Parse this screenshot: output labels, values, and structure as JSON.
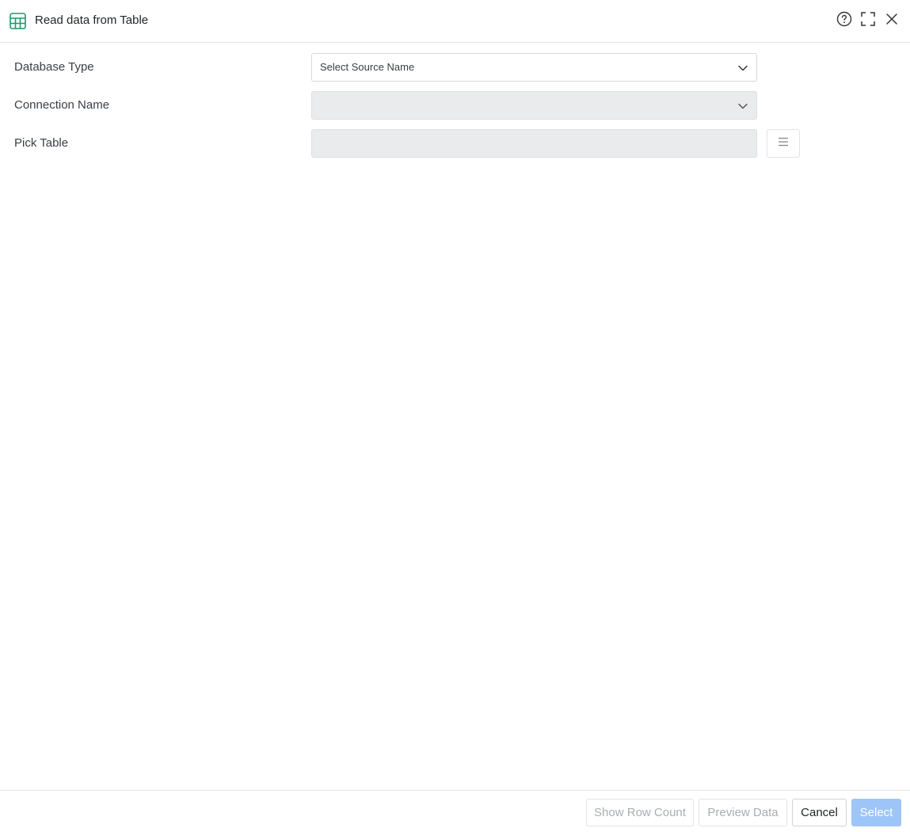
{
  "dialog": {
    "title": "Read data from Table",
    "icon": "table-icon",
    "accent_color": "#1a9a6a"
  },
  "header_actions": {
    "help_icon": "help-circle-icon",
    "maximize_icon": "maximize-icon",
    "close_icon": "close-icon"
  },
  "form": {
    "database_type": {
      "label": "Database Type",
      "value": "Select Source Name",
      "enabled": true
    },
    "connection_name": {
      "label": "Connection Name",
      "value": "",
      "enabled": false
    },
    "pick_table": {
      "label": "Pick Table",
      "value": "",
      "enabled": false,
      "browse_icon": "list-icon"
    }
  },
  "footer": {
    "show_row_count_label": "Show Row Count",
    "preview_data_label": "Preview Data",
    "cancel_label": "Cancel",
    "select_label": "Select",
    "primary_color": "#9ec5f8"
  }
}
